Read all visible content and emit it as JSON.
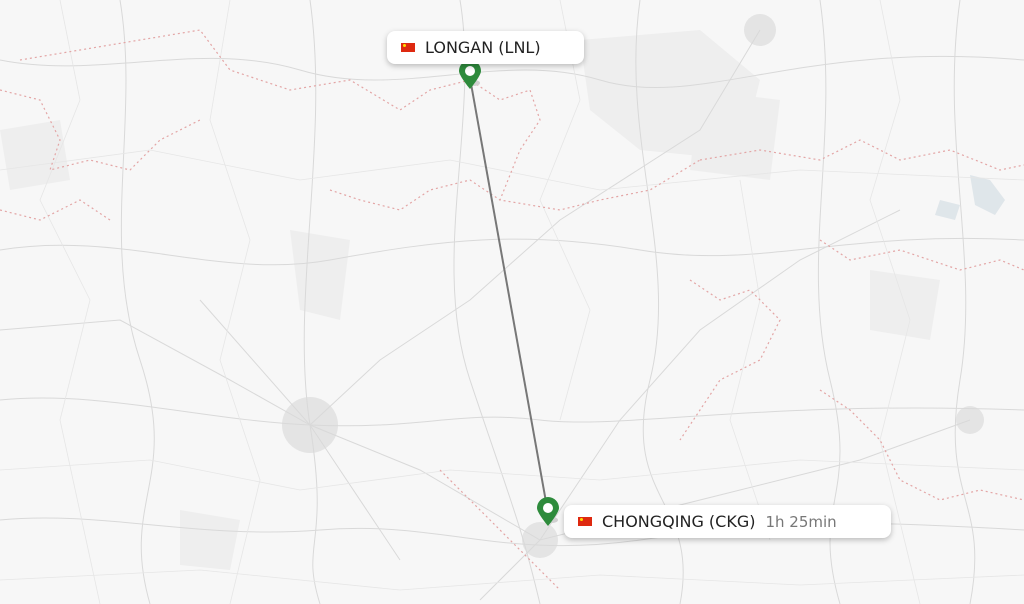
{
  "route": {
    "origin": {
      "name": "LONGAN (LNL)",
      "country_flag": "china-flag"
    },
    "destination": {
      "name": "CHONGQING (CKG)",
      "country_flag": "china-flag",
      "duration": "1h 25min"
    }
  },
  "colors": {
    "pin": "#2e8b3c",
    "route_line": "#777777",
    "border_dotted": "#e5a3a3",
    "road": "#d9d9d9",
    "background": "#f7f7f7"
  }
}
